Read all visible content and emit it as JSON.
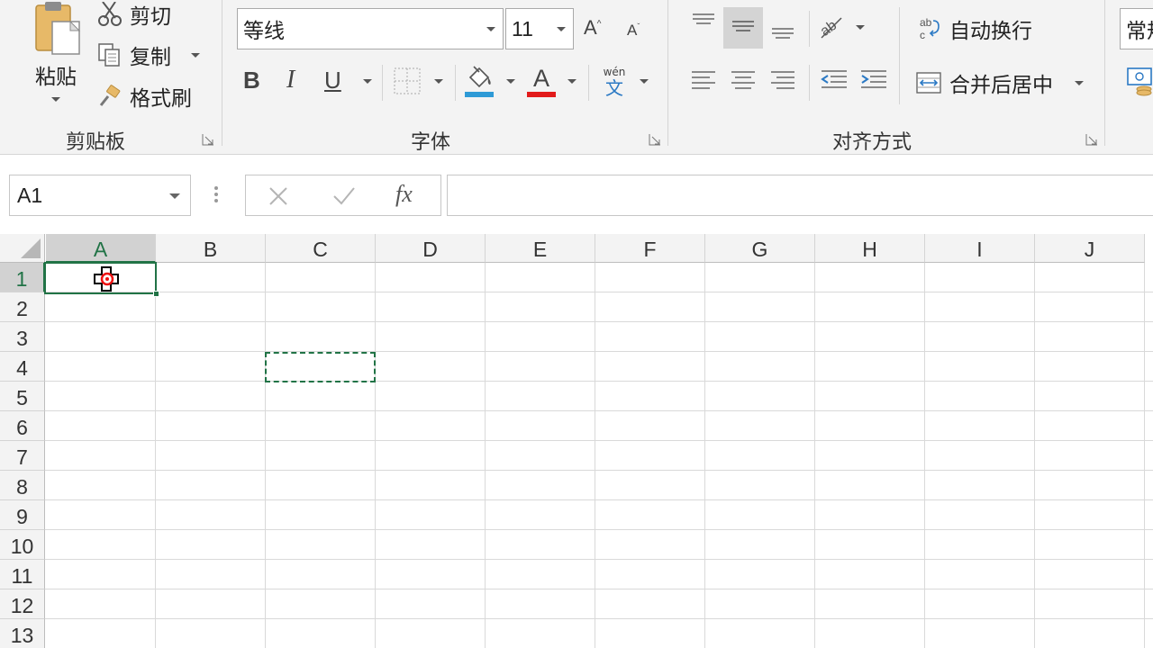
{
  "ribbon": {
    "clipboard": {
      "paste_label": "粘贴",
      "cut_label": "剪切",
      "copy_label": "复制",
      "format_painter_label": "格式刷",
      "group_title": "剪贴板"
    },
    "font": {
      "font_name": "等线",
      "font_size": "11",
      "bold": "B",
      "italic": "I",
      "underline": "U",
      "phonetic_top": "wén",
      "phonetic_bottom": "文",
      "group_title": "字体",
      "fill_color": "#2e9ad6",
      "font_color": "#e21b1b"
    },
    "alignment": {
      "wrap_text_label": "自动换行",
      "merge_center_label": "合并后居中",
      "group_title": "对齐方式"
    },
    "number": {
      "format_value": "常规"
    }
  },
  "formula_bar": {
    "name_box": "A1",
    "fx": "fx",
    "formula": ""
  },
  "sheet": {
    "columns": [
      "A",
      "B",
      "C",
      "D",
      "E",
      "F",
      "G",
      "H",
      "I",
      "J"
    ],
    "rows": [
      "1",
      "2",
      "3",
      "4",
      "5",
      "6",
      "7",
      "8",
      "9",
      "10",
      "11",
      "12",
      "13"
    ],
    "active_cell": "A1",
    "copy_marquee_cell": "C4",
    "accent_color": "#217346"
  }
}
